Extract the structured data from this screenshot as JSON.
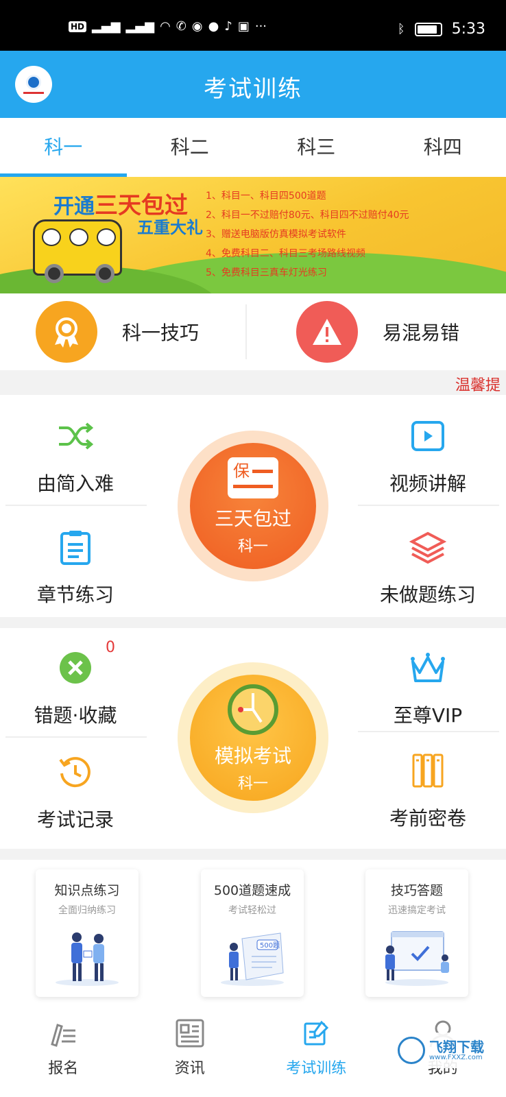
{
  "status_bar": {
    "left_icons": [
      "HD",
      "4G",
      "4G"
    ],
    "time": "5:33"
  },
  "header": {
    "title": "考试训练"
  },
  "tabs": [
    {
      "label": "科一",
      "active": true
    },
    {
      "label": "科二",
      "active": false
    },
    {
      "label": "科三",
      "active": false
    },
    {
      "label": "科四",
      "active": false
    }
  ],
  "banner": {
    "headline_prefix": "开通",
    "headline_highlight": "三天包过",
    "subline": "五重大礼",
    "items": [
      "1、科目一、科目四500道题",
      "2、科目一不过赔付80元、科目四不过赔付40元",
      "3、赠送电脑版仿真模拟考试软件",
      "4、免费科目二、科目三考场路线视频",
      "5、免费科目三真车灯光练习"
    ]
  },
  "quick": {
    "tips_label": "科一技巧",
    "mistakes_label": "易混易错"
  },
  "notice": {
    "text": "温馨提"
  },
  "grid1": {
    "easy_to_hard": "由简入难",
    "video": "视频讲解",
    "chapter": "章节练习",
    "undone": "未做题练习",
    "center_title": "三天包过",
    "center_sub": "科一",
    "center_badge": "保"
  },
  "grid2": {
    "wrong_fav": "错题·收藏",
    "wrong_count": "0",
    "vip": "至尊VIP",
    "records": "考试记录",
    "secret": "考前密卷",
    "center_title": "模拟考试",
    "center_sub": "科一"
  },
  "cards": [
    {
      "title": "知识点练习",
      "subtitle": "全面归纳练习"
    },
    {
      "title": "500道题速成",
      "subtitle": "考试轻松过",
      "tag": "500题"
    },
    {
      "title": "技巧答题",
      "subtitle": "迅速搞定考试"
    }
  ],
  "bottom_nav": [
    {
      "label": "报名",
      "icon": "pen-list-icon"
    },
    {
      "label": "资讯",
      "icon": "news-icon"
    },
    {
      "label": "考试训练",
      "icon": "edit-icon",
      "active": true
    },
    {
      "label": "我的",
      "icon": "user-icon"
    }
  ],
  "watermark": {
    "text": "飞翔下载",
    "url": "www.FXXZ.com"
  },
  "colors": {
    "primary": "#26a7ee",
    "orange": "#f7a520",
    "red": "#f05c57",
    "notice": "#d9302c"
  }
}
